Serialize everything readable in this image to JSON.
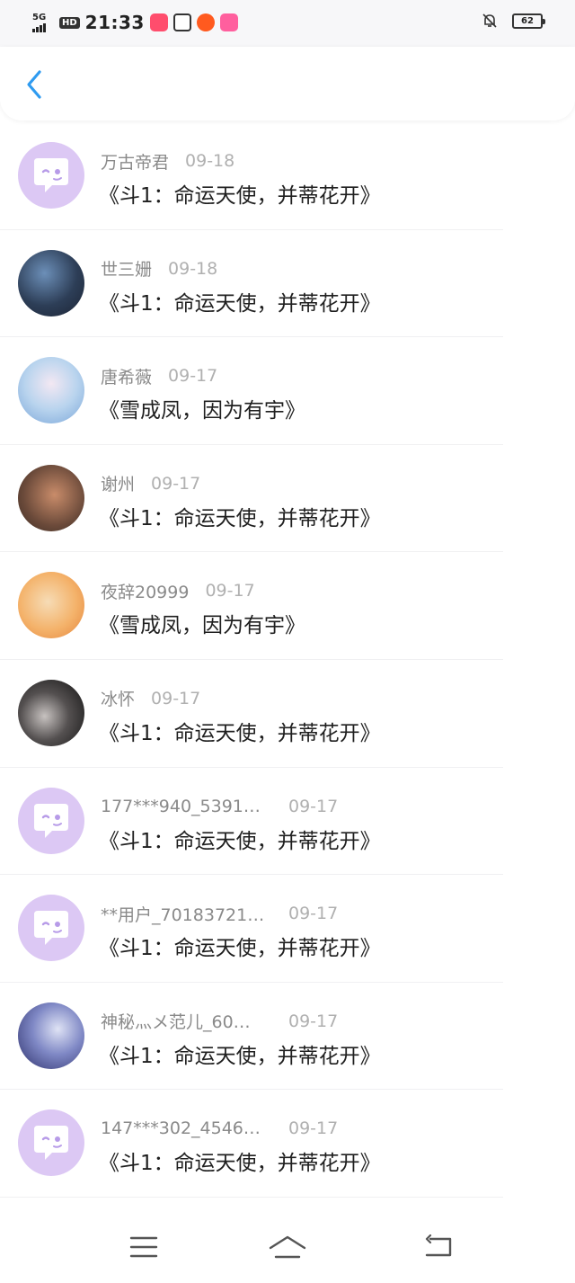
{
  "status_bar": {
    "network": "5G",
    "hd": "HD",
    "time": "21:33",
    "battery": "62"
  },
  "header": {
    "back_icon": "chevron-left-icon",
    "accent_color": "#2f9bf0"
  },
  "list": [
    {
      "name": "万古帝君",
      "date": "09-18",
      "message": "《斗1：命运天使，并蒂花开》",
      "avatar": "default-chat-bubble"
    },
    {
      "name": "世三姗",
      "date": "09-18",
      "message": "《斗1：命运天使，并蒂花开》",
      "avatar": "photo"
    },
    {
      "name": "唐希薇",
      "date": "09-17",
      "message": "《雪成凤，因为有宇》",
      "avatar": "photo"
    },
    {
      "name": "谢州",
      "date": "09-17",
      "message": "《斗1：命运天使，并蒂花开》",
      "avatar": "photo"
    },
    {
      "name": "夜辞20999",
      "date": "09-17",
      "message": "《雪成凤，因为有宇》",
      "avatar": "photo"
    },
    {
      "name": "冰怀",
      "date": "09-17",
      "message": "《斗1：命运天使，并蒂花开》",
      "avatar": "photo"
    },
    {
      "name": "177***940_5391…",
      "date": "09-17",
      "message": "《斗1：命运天使，并蒂花开》",
      "avatar": "default-chat-bubble"
    },
    {
      "name": "**用户_70183721…",
      "date": "09-17",
      "message": "《斗1：命运天使，并蒂花开》",
      "avatar": "default-chat-bubble"
    },
    {
      "name": "神秘灬メ范儿_60…",
      "date": "09-17",
      "message": "《斗1：命运天使，并蒂花开》",
      "avatar": "photo"
    },
    {
      "name": "147***302_4546…",
      "date": "09-17",
      "message": "《斗1：命运天使，并蒂花开》",
      "avatar": "default-chat-bubble"
    }
  ],
  "nav_bar": {
    "icons": [
      "menu-icon",
      "home-icon",
      "back-icon"
    ]
  }
}
